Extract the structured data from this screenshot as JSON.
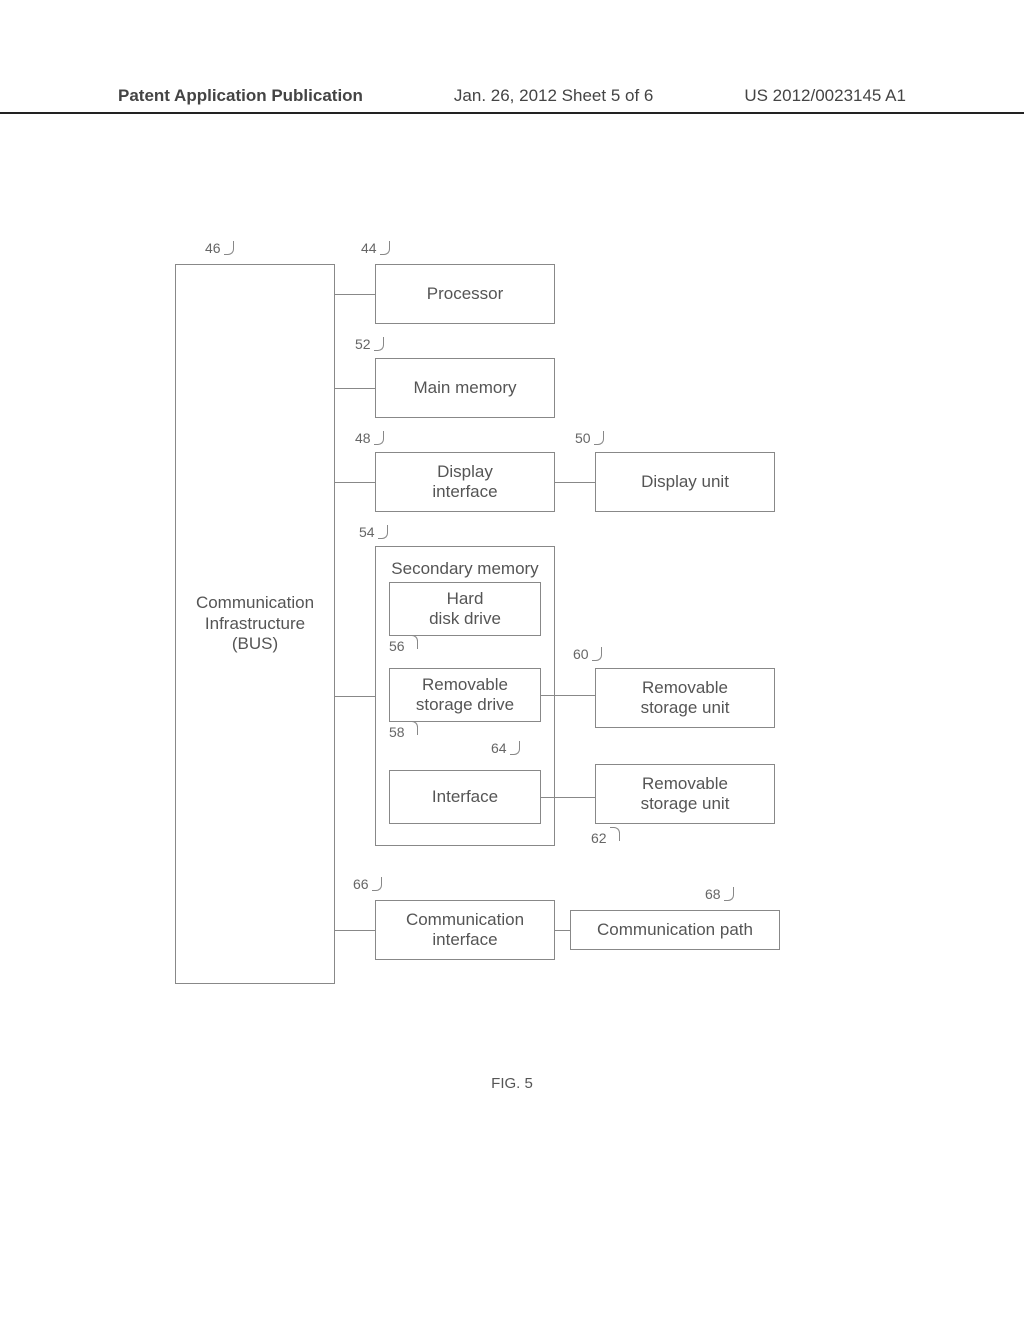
{
  "header": {
    "left": "Patent Application Publication",
    "mid": "Jan. 26, 2012  Sheet 5 of 6",
    "right": "US 2012/0023145 A1"
  },
  "blocks": {
    "bus": "Communication\nInfrastructure\n(BUS)",
    "processor": "Processor",
    "main_memory": "Main memory",
    "display_interface": "Display\ninterface",
    "display_unit": "Display unit",
    "secondary_memory": "Secondary memory",
    "hard_disk": "Hard\ndisk drive",
    "removable_drive": "Removable\nstorage drive",
    "interface": "Interface",
    "removable_unit_1": "Removable\nstorage unit",
    "removable_unit_2": "Removable\nstorage unit",
    "comm_interface": "Communication\ninterface",
    "comm_path": "Communication path"
  },
  "refs": {
    "r46": "46",
    "r44": "44",
    "r52": "52",
    "r48": "48",
    "r50": "50",
    "r54": "54",
    "r56": "56",
    "r58": "58",
    "r64": "64",
    "r60": "60",
    "r62": "62",
    "r66": "66",
    "r68": "68"
  },
  "caption": "FIG. 5"
}
